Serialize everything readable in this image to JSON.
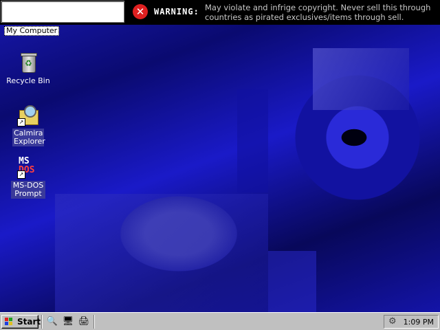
{
  "topbar": {
    "warning_label": "WARNING:",
    "warning_text": "May violate and infrige copyright. Never sell this through countries as pirated exclusives/items through sell.",
    "input_value": ""
  },
  "desktop": {
    "icons": [
      {
        "label": "My Computer",
        "icon": "my-computer-icon"
      },
      {
        "label": "Recycle Bin",
        "icon": "recycle-bin-icon"
      },
      {
        "label": "Calmira Explorer",
        "icon": "calmira-explorer-icon"
      },
      {
        "label": "MS-DOS Prompt",
        "icon": "ms-dos-icon"
      }
    ]
  },
  "taskbar": {
    "start_label": "Start",
    "quick_launch": [
      "explorer-icon",
      "desktop-icon",
      "printer-icon"
    ],
    "clock": "1:09 PM"
  },
  "msdos_icon_text": {
    "top": "MS",
    "bottom": "DOS"
  }
}
